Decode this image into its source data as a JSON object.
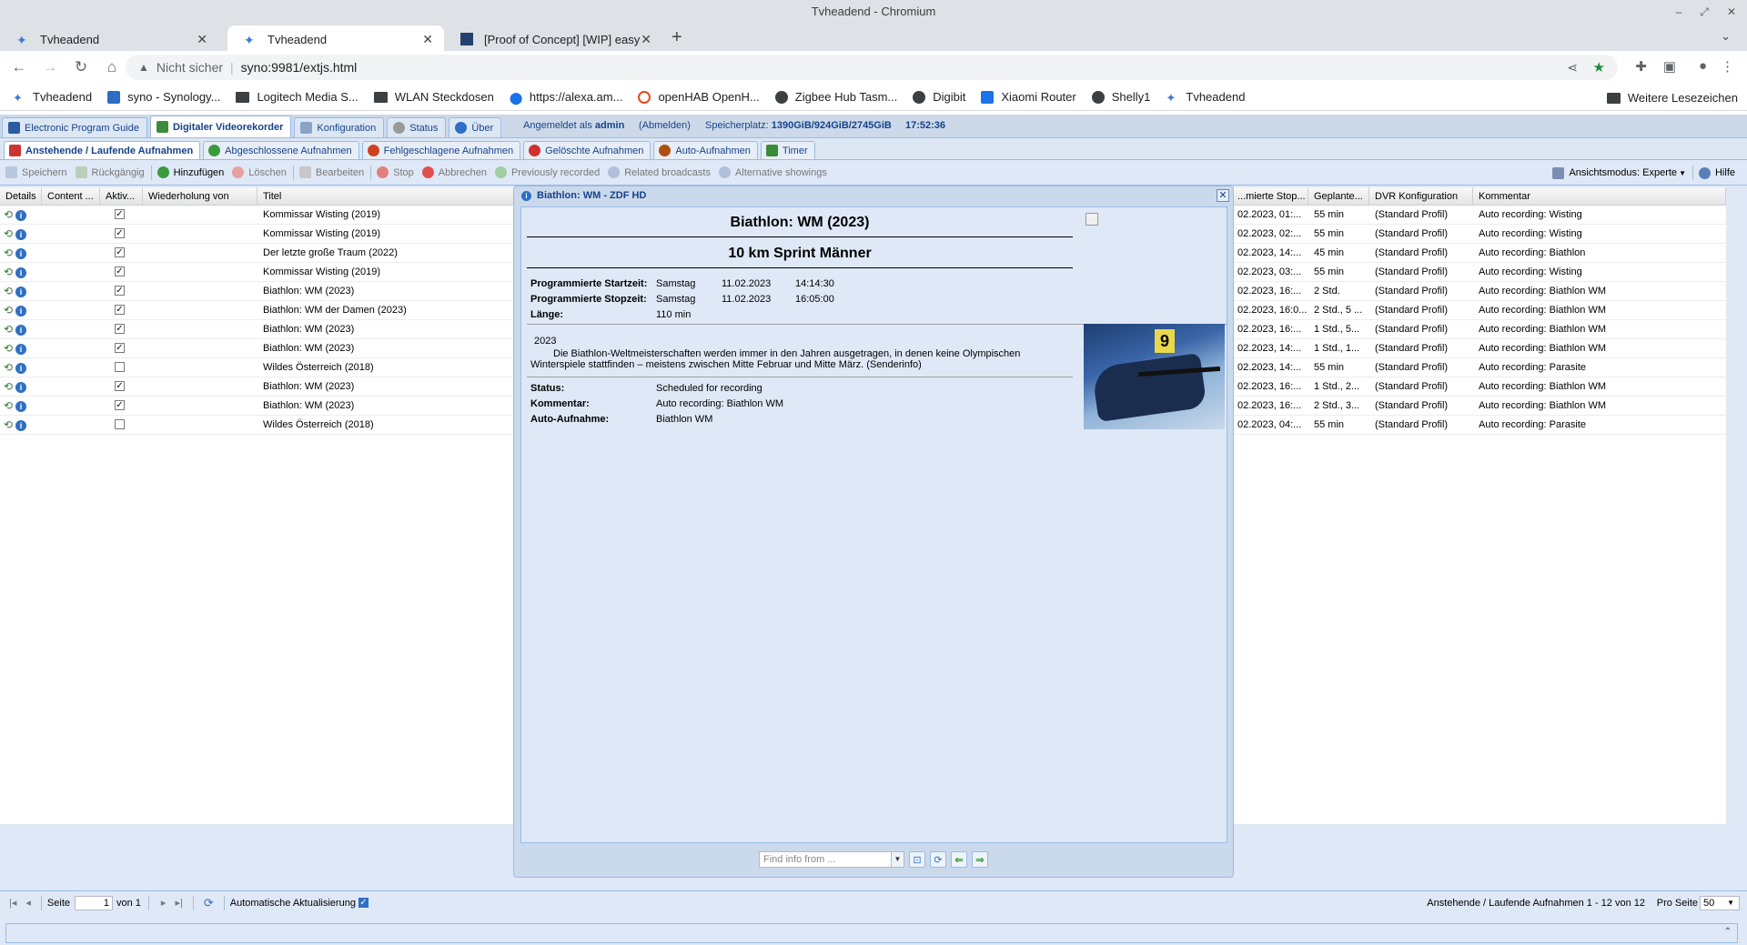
{
  "browser": {
    "window_title": "Tvheadend - Chromium",
    "tabs": [
      {
        "label": "Tvheadend"
      },
      {
        "label": "Tvheadend"
      },
      {
        "label": "[Proof of Concept] [WIP] easy"
      }
    ],
    "security_label": "Nicht sicher",
    "url": "syno:9981/extjs.html",
    "bookmarks": [
      {
        "label": "Tvheadend"
      },
      {
        "label": "syno - Synology..."
      },
      {
        "label": "Logitech Media S..."
      },
      {
        "label": "WLAN Steckdosen"
      },
      {
        "label": "https://alexa.am..."
      },
      {
        "label": "openHAB OpenH..."
      },
      {
        "label": "Zigbee Hub Tasm..."
      },
      {
        "label": "Digibit"
      },
      {
        "label": "Xiaomi Router"
      },
      {
        "label": "Shelly1"
      },
      {
        "label": "Tvheadend"
      }
    ],
    "more_bookmarks": "Weitere Lesezeichen"
  },
  "app": {
    "main_tabs": [
      "Electronic Program Guide",
      "Digitaler Videorekorder",
      "Konfiguration",
      "Status",
      "Über"
    ],
    "logged_in_prefix": "Angemeldet als",
    "user": "admin",
    "logout": "(Abmelden)",
    "storage_label": "Speicherplatz:",
    "storage_value": "1390GiB/924GiB/2745GiB",
    "clock": "17:52:36",
    "sub_tabs": [
      "Anstehende / Laufende Aufnahmen",
      "Abgeschlossene Aufnahmen",
      "Fehlgeschlagene Aufnahmen",
      "Gelöschte Aufnahmen",
      "Auto-Aufnahmen",
      "Timer"
    ],
    "toolbar": {
      "save": "Speichern",
      "undo": "Rückgängig",
      "add": "Hinzufügen",
      "delete": "Löschen",
      "edit": "Bearbeiten",
      "stop": "Stop",
      "abort": "Abbrechen",
      "prev_recorded": "Previously recorded",
      "related": "Related broadcasts",
      "alternative": "Alternative showings",
      "view_mode": "Ansichtsmodus: Experte",
      "help": "Hilfe"
    },
    "grid": {
      "headers": [
        "Details",
        "Content ...",
        "Aktiv...",
        "Wiederholung von",
        "Titel",
        "...mierte Stop...",
        "Geplante...",
        "DVR Konfiguration",
        "Kommentar"
      ],
      "rows": [
        {
          "active": true,
          "title": "Kommissar Wisting (2019)",
          "stop": "02.2023, 01:...",
          "duration": "55 min",
          "config": "(Standard Profil)",
          "comment": "Auto recording: Wisting"
        },
        {
          "active": true,
          "title": "Kommissar Wisting (2019)",
          "stop": "02.2023, 02:...",
          "duration": "55 min",
          "config": "(Standard Profil)",
          "comment": "Auto recording: Wisting"
        },
        {
          "active": true,
          "title": "Der letzte große Traum (2022)",
          "stop": "02.2023, 14:...",
          "duration": "45 min",
          "config": "(Standard Profil)",
          "comment": "Auto recording: Biathlon"
        },
        {
          "active": true,
          "title": "Kommissar Wisting (2019)",
          "stop": "02.2023, 03:...",
          "duration": "55 min",
          "config": "(Standard Profil)",
          "comment": "Auto recording: Wisting"
        },
        {
          "active": true,
          "title": "Biathlon: WM (2023)",
          "stop": "02.2023, 16:...",
          "duration": "2 Std.",
          "config": "(Standard Profil)",
          "comment": "Auto recording: Biathlon WM"
        },
        {
          "active": true,
          "title": "Biathlon: WM der Damen (2023)",
          "stop": "02.2023, 16:0...",
          "duration": "2 Std., 5 ...",
          "config": "(Standard Profil)",
          "comment": "Auto recording: Biathlon WM"
        },
        {
          "active": true,
          "title": "Biathlon: WM (2023)",
          "stop": "02.2023, 16:...",
          "duration": "1 Std., 5...",
          "config": "(Standard Profil)",
          "comment": "Auto recording: Biathlon WM"
        },
        {
          "active": true,
          "title": "Biathlon: WM (2023)",
          "stop": "02.2023, 14:...",
          "duration": "1 Std., 1...",
          "config": "(Standard Profil)",
          "comment": "Auto recording: Biathlon WM"
        },
        {
          "active": false,
          "title": "Wildes Österreich (2018)",
          "stop": "02.2023, 14:...",
          "duration": "55 min",
          "config": "(Standard Profil)",
          "comment": "Auto recording: Parasite"
        },
        {
          "active": true,
          "title": "Biathlon: WM (2023)",
          "stop": "02.2023, 16:...",
          "duration": "1 Std., 2...",
          "config": "(Standard Profil)",
          "comment": "Auto recording: Biathlon WM"
        },
        {
          "active": true,
          "title": "Biathlon: WM (2023)",
          "stop": "02.2023, 16:...",
          "duration": "2 Std., 3...",
          "config": "(Standard Profil)",
          "comment": "Auto recording: Biathlon WM"
        },
        {
          "active": false,
          "title": "Wildes Österreich (2018)",
          "stop": "02.2023, 04:...",
          "duration": "55 min",
          "config": "(Standard Profil)",
          "comment": "Auto recording: Parasite"
        }
      ]
    },
    "pager": {
      "page_label": "Seite",
      "page": "1",
      "of": "von 1",
      "auto_refresh": "Automatische Aktualisierung",
      "summary": "Anstehende / Laufende Aufnahmen 1 - 12 von 12",
      "per_page_label": "Pro Seite",
      "per_page": "50"
    }
  },
  "dialog": {
    "title": "Biathlon: WM - ZDF HD",
    "heading": "Biathlon: WM (2023)",
    "subtitle": "10 km Sprint Männer",
    "start_label": "Programmierte Startzeit:",
    "start_day": "Samstag",
    "start_date": "11.02.2023",
    "start_time": "14:14:30",
    "stop_label": "Programmierte Stopzeit:",
    "stop_day": "Samstag",
    "stop_date": "11.02.2023",
    "stop_time": "16:05:00",
    "length_label": "Länge:",
    "length": "110 min",
    "year": "2023",
    "description": "Die Biathlon-Weltmeisterschaften werden immer in den Jahren ausgetragen, in denen keine Olympischen Winterspiele stattfinden – meistens zwischen Mitte Februar und Mitte März. (Senderinfo)",
    "status_label": "Status:",
    "status": "Scheduled for recording",
    "comment_label": "Kommentar:",
    "comment": "Auto recording: Biathlon WM",
    "autorec_label": "Auto-Aufnahme:",
    "autorec": "Biathlon WM",
    "find_placeholder": "Find info from ...",
    "image_text": "9"
  }
}
